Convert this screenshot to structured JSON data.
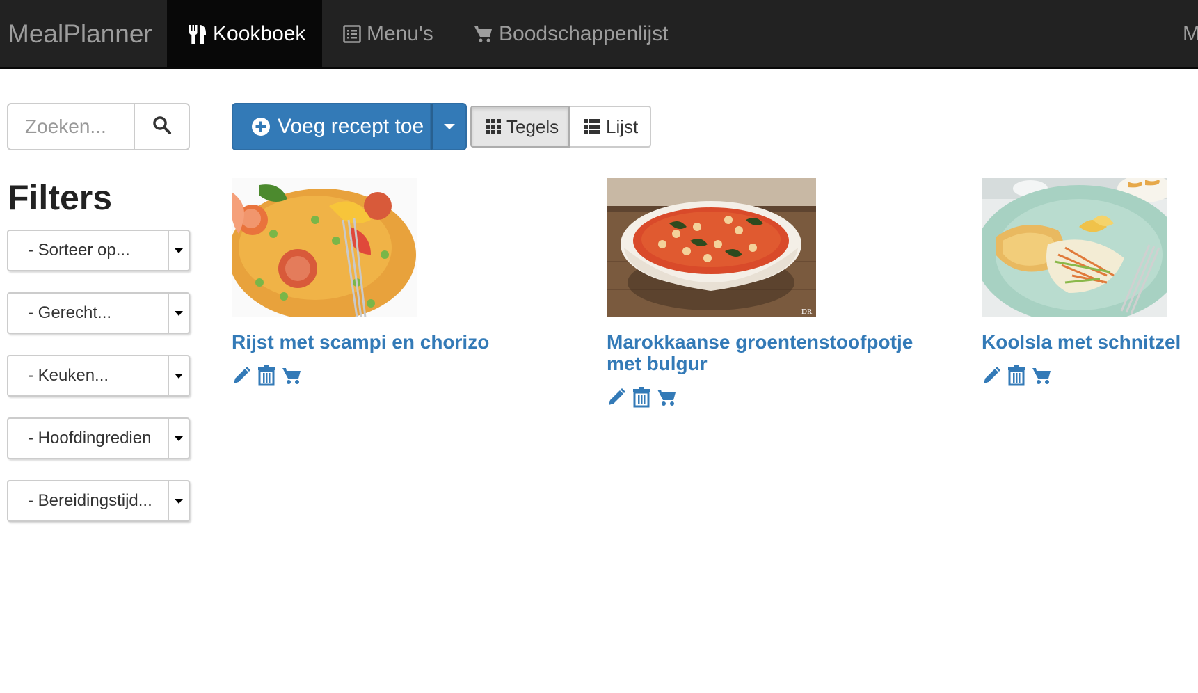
{
  "navbar": {
    "brand": "MealPlanner",
    "items": [
      {
        "label": "Kookboek",
        "icon": "cutlery-icon",
        "active": true
      },
      {
        "label": "Menu's",
        "icon": "list-alt-icon",
        "active": false
      },
      {
        "label": "Boodschappenlijst",
        "icon": "shopping-cart-icon",
        "active": false
      },
      {
        "label": "M",
        "icon": "",
        "active": false
      }
    ]
  },
  "search": {
    "placeholder": "Zoeken...",
    "button_icon": "search-icon"
  },
  "filters": {
    "title": "Filters",
    "selects": [
      {
        "selected": "- Sorteer op..."
      },
      {
        "selected": "- Gerecht..."
      },
      {
        "selected": "- Keuken..."
      },
      {
        "selected": "- Hoofdingredien"
      },
      {
        "selected": "- Bereidingstijd..."
      }
    ]
  },
  "toolbar": {
    "add_label": "Voeg recept toe",
    "add_icon": "plus-circle-icon",
    "view_tiles": "Tegels",
    "view_list": "Lijst",
    "active_view": "Tegels"
  },
  "recipes": [
    {
      "title": "Rijst met scampi en chorizo",
      "image": "paella-photo"
    },
    {
      "title": "Marokkaanse groentenstoofpotje met bulgur",
      "image": "stew-bowl-photo",
      "image_caption": "DR"
    },
    {
      "title": "Koolsla met schnitzel",
      "image": "schnitzel-plate-photo"
    }
  ],
  "colors": {
    "navbar_bg": "#222222",
    "primary": "#337ab7",
    "link": "#337ab7"
  }
}
